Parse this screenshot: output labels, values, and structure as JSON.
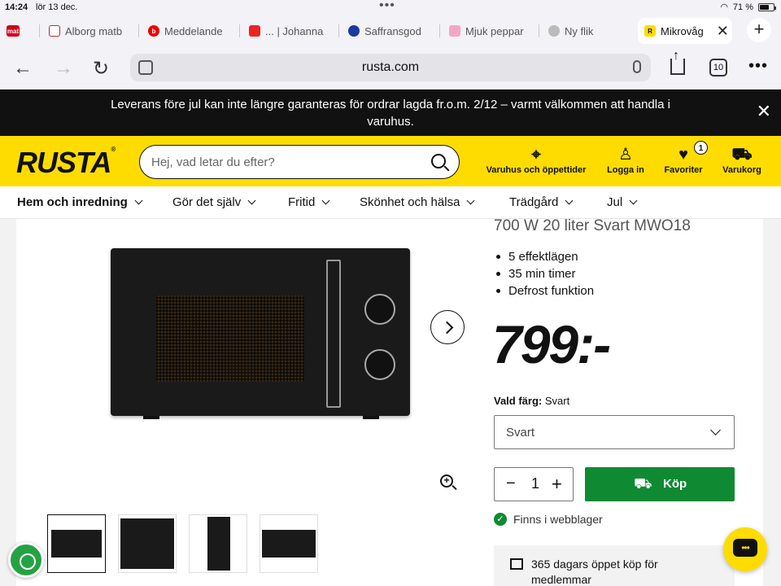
{
  "status": {
    "time": "14:24",
    "date": "lör 13 dec.",
    "battery": "71 %",
    "battery_level": 0.71
  },
  "browser": {
    "tabs": [
      {
        "label": "",
        "icon": "mat-favicon",
        "color": "#d0021b"
      },
      {
        "label": "Alborg matb",
        "icon": "shield-favicon",
        "color": "#a33"
      },
      {
        "label": "Meddelande",
        "icon": "b-favicon",
        "color": "#e00"
      },
      {
        "label": "... | Johanna",
        "icon": "red-favicon",
        "color": "#e22"
      },
      {
        "label": "Saffransgod",
        "icon": "circle-favicon",
        "color": "#1a3aa0"
      },
      {
        "label": "Mjuk peppar",
        "icon": "pink-favicon",
        "color": "#f4a7c3"
      },
      {
        "label": "Ny flik",
        "icon": "globe-favicon",
        "color": "#999"
      },
      {
        "label": "Mikrovåg",
        "icon": "rusta-favicon",
        "color": "#ffdc00"
      }
    ],
    "url": "rusta.com",
    "tab_count": "10"
  },
  "announcement": {
    "text": "Leverans före jul kan inte längre garanteras för ordrar lagda fr.o.m. 2/12 – varmt välkommen att handla i varuhus."
  },
  "header": {
    "logo": "RUSTA",
    "search_placeholder": "Hej, vad letar du efter?",
    "stores_label": "Varuhus och öppettider",
    "login_label": "Logga in",
    "favorites_label": "Favoriter",
    "favorites_count": "1",
    "cart_label": "Varukorg"
  },
  "nav": {
    "items": [
      "Hem och inredning",
      "Gör det själv",
      "Fritid",
      "Skönhet och hälsa",
      "Trädgård",
      "Jul"
    ]
  },
  "product": {
    "title": "700 W 20 liter Svart MWO18",
    "features": [
      "5 effektlägen",
      "35 min timer",
      "Defrost funktion"
    ],
    "price": "799:-",
    "color_label": "Vald färg:",
    "color_value": "Svart",
    "select_value": "Svart",
    "quantity": "1",
    "buy_label": "Köp",
    "stock_text": "Finns i webblager",
    "member_text": "365 dagars öppet köp för medlemmar"
  }
}
